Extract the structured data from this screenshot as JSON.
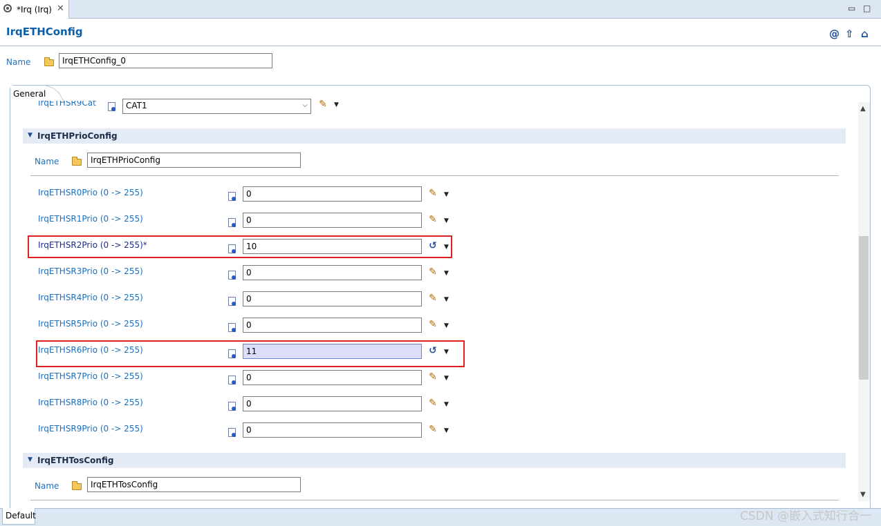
{
  "editor_tab": {
    "label": "*Irq (Irq)",
    "close": "✕"
  },
  "window_controls": {
    "minimize": "▭",
    "maximize": "□"
  },
  "form": {
    "title": "IrqETHConfig",
    "toolbar_icons": [
      "at-icon",
      "up-arrow-icon",
      "home-icon"
    ],
    "name_label": "Name",
    "name_value": "IrqETHConfig_0"
  },
  "general_tab": {
    "label": "General"
  },
  "clipped_row": {
    "label": "IrqETHSR9Cat",
    "value": "CAT1"
  },
  "prio_section": {
    "title": "IrqETHPrioConfig",
    "name_label": "Name",
    "name_value": "IrqETHPrioConfig",
    "rows": [
      {
        "label": "IrqETHSR0Prio (0 -> 255)",
        "value": "0",
        "modified": false,
        "highlighted": false
      },
      {
        "label": "IrqETHSR1Prio (0 -> 255)",
        "value": "0",
        "modified": false,
        "highlighted": false
      },
      {
        "label": "IrqETHSR2Prio (0 -> 255)*",
        "value": "10",
        "modified": true,
        "highlighted": true
      },
      {
        "label": "IrqETHSR3Prio (0 -> 255)",
        "value": "0",
        "modified": false,
        "highlighted": false
      },
      {
        "label": "IrqETHSR4Prio (0 -> 255)",
        "value": "0",
        "modified": false,
        "highlighted": false
      },
      {
        "label": "IrqETHSR5Prio (0 -> 255)",
        "value": "0",
        "modified": false,
        "highlighted": false
      },
      {
        "label": "IrqETHSR6Prio (0 -> 255)",
        "value": "11",
        "modified": false,
        "highlighted": true,
        "selected": true
      },
      {
        "label": "IrqETHSR7Prio (0 -> 255)",
        "value": "0",
        "modified": false,
        "highlighted": false
      },
      {
        "label": "IrqETHSR8Prio (0 -> 255)",
        "value": "0",
        "modified": false,
        "highlighted": false
      },
      {
        "label": "IrqETHSR9Prio (0 -> 255)",
        "value": "0",
        "modified": false,
        "highlighted": false
      }
    ]
  },
  "tos_section": {
    "title": "IrqETHTosConfig",
    "name_label": "Name",
    "name_value": "IrqETHTosConfig"
  },
  "bottom_tab": {
    "label": "Default"
  },
  "watermark": "CSDN @嵌入式知行合一",
  "colors": {
    "label_blue": "#1e6fbb",
    "highlight_red": "#e02020",
    "section_bg": "#e4ebf5",
    "selected_input": "#ddddf9"
  }
}
